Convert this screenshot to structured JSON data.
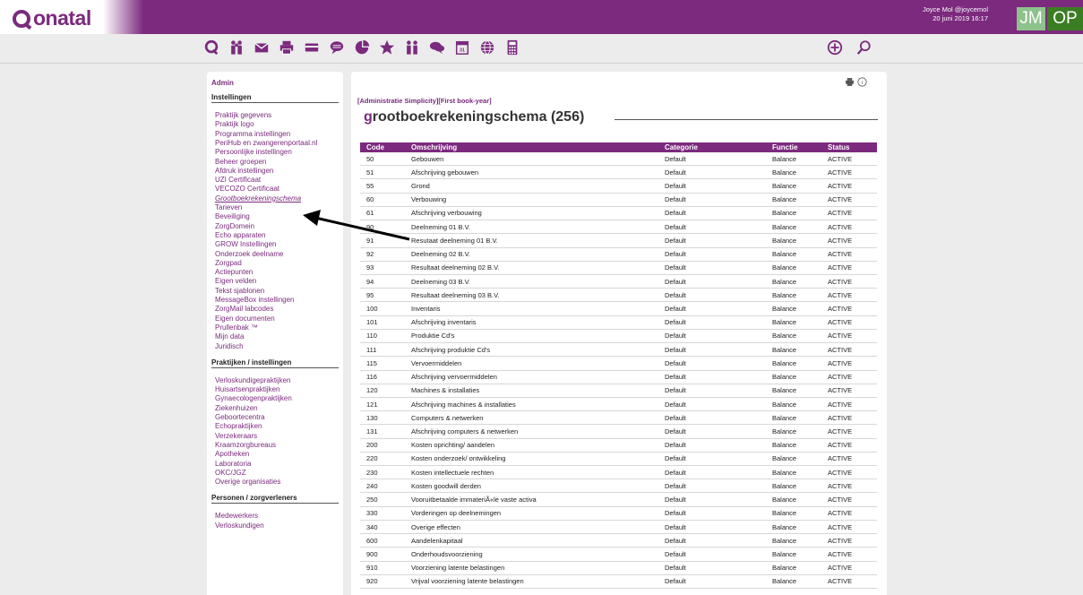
{
  "app": {
    "logo_text": "onatal",
    "user_line1": "Joyce Mol @joycemol",
    "user_line2": "20 juni 2019 16:17",
    "badge_jm": "JM",
    "badge_op": "OP"
  },
  "toolbar_icons": [
    "logo-q-icon",
    "people-icon",
    "mail-icon",
    "printer-icon",
    "card-icon",
    "chat-bubble-icon",
    "pie-chart-icon",
    "star-icon",
    "people-group-icon",
    "chat-icon",
    "calendar-icon",
    "globe-icon",
    "calculator-icon"
  ],
  "toolbar_right_icons": [
    "plus-circle-icon",
    "search-icon"
  ],
  "sidebar": {
    "title": "Admin",
    "sections": [
      {
        "heading": "Instellingen",
        "items": [
          "Praktijk gegevens",
          "Praktijk logo",
          "Programma instellingen",
          "PeriHub en zwangerenportaal.nl",
          "Persoonlijke instellingen",
          "Beheer groepen",
          "Afdruk instellingen",
          "UZI Certificaat",
          "VECOZO Certificaat",
          "Grootboekrekeningschema",
          "Tarieven",
          "Beveiliging",
          "ZorgDomein",
          "Echo apparaten",
          "GROW Instellingen",
          "Onderzoek deelname",
          "Zorgpad",
          "Actiepunten",
          "Eigen velden",
          "Tekst sjablonen",
          "MessageBox instellingen",
          "ZorgMail labcodes",
          "Eigen documenten",
          "Prullenbak ™",
          "Mijn data",
          "Juridisch"
        ]
      },
      {
        "heading": "Praktijken / instellingen",
        "items": [
          "Verloskundigepraktijken",
          "Huisartsenpraktijken",
          "Gynaecologenpraktijken",
          "Ziekenhuizen",
          "Geboortecentra",
          "Echopraktijken",
          "Verzekeraars",
          "Kraamzorgbureaus",
          "Apotheken",
          "Laboratoria",
          "OKC/JGZ",
          "Overige organisaties"
        ]
      },
      {
        "heading": "Personen / zorgverleners",
        "items": [
          "Medewerkers",
          "Verloskundigen"
        ]
      }
    ]
  },
  "main": {
    "breadcrumb": "[Administratie Simplicity][First book-year]",
    "title_first": "g",
    "title_rest": "rootboekrekeningschema (256)",
    "columns": [
      "Code",
      "Omschrijving",
      "Categorie",
      "Functie",
      "Status"
    ],
    "rows": [
      [
        "50",
        "Gebouwen",
        "Default",
        "Balance",
        "ACTIVE"
      ],
      [
        "51",
        "Afschrijving gebouwen",
        "Default",
        "Balance",
        "ACTIVE"
      ],
      [
        "55",
        "Grond",
        "Default",
        "Balance",
        "ACTIVE"
      ],
      [
        "60",
        "Verbouwing",
        "Default",
        "Balance",
        "ACTIVE"
      ],
      [
        "61",
        "Afschrijving verbouwing",
        "Default",
        "Balance",
        "ACTIVE"
      ],
      [
        "90",
        "Deelneming 01 B.V.",
        "Default",
        "Balance",
        "ACTIVE"
      ],
      [
        "91",
        "Resutaat deelneming 01 B.V.",
        "Default",
        "Balance",
        "ACTIVE"
      ],
      [
        "92",
        "Deelneming 02 B.V.",
        "Default",
        "Balance",
        "ACTIVE"
      ],
      [
        "93",
        "Resultaat deelneming 02 B.V.",
        "Default",
        "Balance",
        "ACTIVE"
      ],
      [
        "94",
        "Deelneming 03 B.V.",
        "Default",
        "Balance",
        "ACTIVE"
      ],
      [
        "95",
        "Resultaat deelneming 03 B.V.",
        "Default",
        "Balance",
        "ACTIVE"
      ],
      [
        "100",
        "Inventaris",
        "Default",
        "Balance",
        "ACTIVE"
      ],
      [
        "101",
        "Afschrijving inventaris",
        "Default",
        "Balance",
        "ACTIVE"
      ],
      [
        "110",
        "Produktie Cd's",
        "Default",
        "Balance",
        "ACTIVE"
      ],
      [
        "111",
        "Afschrijving produktie Cd's",
        "Default",
        "Balance",
        "ACTIVE"
      ],
      [
        "115",
        "Vervoermiddelen",
        "Default",
        "Balance",
        "ACTIVE"
      ],
      [
        "116",
        "Afschrijving vervoermiddelen",
        "Default",
        "Balance",
        "ACTIVE"
      ],
      [
        "120",
        "Machines & installaties",
        "Default",
        "Balance",
        "ACTIVE"
      ],
      [
        "121",
        "Afschrijving machines & installaties",
        "Default",
        "Balance",
        "ACTIVE"
      ],
      [
        "130",
        "Computers & netwerken",
        "Default",
        "Balance",
        "ACTIVE"
      ],
      [
        "131",
        "Afschrijving computers & netwerken",
        "Default",
        "Balance",
        "ACTIVE"
      ],
      [
        "200",
        "Kosten oprichting/ aandelen",
        "Default",
        "Balance",
        "ACTIVE"
      ],
      [
        "220",
        "Kosten onderzoek/ ontwikkeling",
        "Default",
        "Balance",
        "ACTIVE"
      ],
      [
        "230",
        "Kosten intellectuele rechten",
        "Default",
        "Balance",
        "ACTIVE"
      ],
      [
        "240",
        "Kosten goodwill derden",
        "Default",
        "Balance",
        "ACTIVE"
      ],
      [
        "250",
        "Vooruitbetaalde immateriÃ«le vaste activa",
        "Default",
        "Balance",
        "ACTIVE"
      ],
      [
        "330",
        "Vorderingen op deelnemingen",
        "Default",
        "Balance",
        "ACTIVE"
      ],
      [
        "340",
        "Overige effecten",
        "Default",
        "Balance",
        "ACTIVE"
      ],
      [
        "600",
        "Aandelenkapitaal",
        "Default",
        "Balance",
        "ACTIVE"
      ],
      [
        "900",
        "Onderhoudsvoorziening",
        "Default",
        "Balance",
        "ACTIVE"
      ],
      [
        "910",
        "Voorziening latente belastingen",
        "Default",
        "Balance",
        "ACTIVE"
      ],
      [
        "920",
        "Vrijval voorziening latente belastingen",
        "Default",
        "Balance",
        "ACTIVE"
      ]
    ]
  },
  "colors": {
    "brand": "#7b2a7e",
    "badge_jm": "#8ec28b",
    "badge_op": "#3b7d23"
  }
}
